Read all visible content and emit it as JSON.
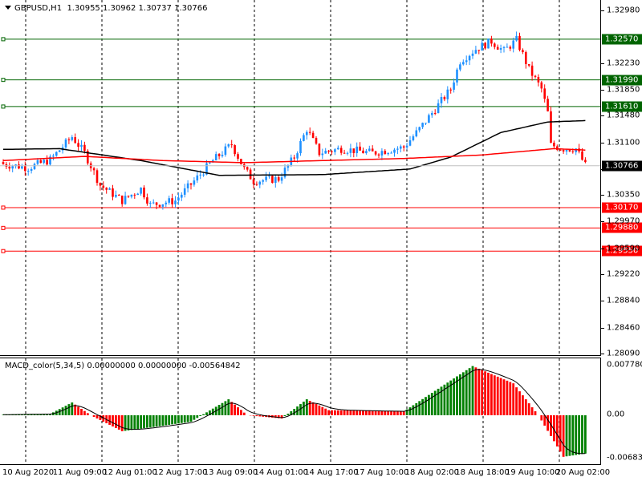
{
  "header": {
    "symbol": "GBPUSD,H1",
    "open": "1.30955",
    "high": "1.30962",
    "low": "1.30737",
    "close": "1.30766"
  },
  "macd": {
    "label": "MACD_color(5,34,5) 0.00000000 0.00000000 -0.00564842",
    "axis": [
      "0.0077804",
      "0.00",
      "-0.006831"
    ]
  },
  "price_axis": [
    "1.32980",
    "1.32230",
    "1.31850",
    "1.31480",
    "1.31100",
    "1.30720",
    "1.30350",
    "1.29970",
    "1.29590",
    "1.29220",
    "1.28840",
    "1.28460",
    "1.28090"
  ],
  "levels": [
    {
      "price": "1.32570",
      "color": "#006400"
    },
    {
      "price": "1.31990",
      "color": "#006400"
    },
    {
      "price": "1.31610",
      "color": "#006400"
    },
    {
      "price": "1.30170",
      "color": "#ff0000"
    },
    {
      "price": "1.29880",
      "color": "#ff0000"
    },
    {
      "price": "1.29550",
      "color": "#ff0000"
    }
  ],
  "current_price": "1.30766",
  "time_axis": [
    "10 Aug 2020",
    "11 Aug 09:00",
    "12 Aug 01:00",
    "12 Aug 17:00",
    "13 Aug 09:00",
    "14 Aug 01:00",
    "14 Aug 17:00",
    "17 Aug 10:00",
    "18 Aug 02:00",
    "18 Aug 18:00",
    "19 Aug 10:00",
    "20 Aug 02:00"
  ],
  "colors": {
    "bull": "#1e90ff",
    "bear": "#ff0000",
    "ma_slow": "#000000",
    "ma_fast": "#ff0000",
    "hist_up": "#008000",
    "hist_down": "#ff0000"
  },
  "chart_data": {
    "type": "candlestick",
    "bars": 187,
    "ylim": [
      1.2809,
      1.3298
    ],
    "close_keypoints": [
      [
        0,
        1.3079
      ],
      [
        8,
        1.3074
      ],
      [
        15,
        1.3085
      ],
      [
        22,
        1.3118
      ],
      [
        26,
        1.3095
      ],
      [
        31,
        1.3049
      ],
      [
        38,
        1.3027
      ],
      [
        44,
        1.3044
      ],
      [
        47,
        1.3021
      ],
      [
        55,
        1.3027
      ],
      [
        61,
        1.3055
      ],
      [
        67,
        1.3084
      ],
      [
        73,
        1.3107
      ],
      [
        77,
        1.3072
      ],
      [
        80,
        1.3055
      ],
      [
        88,
        1.3058
      ],
      [
        93,
        1.3089
      ],
      [
        97,
        1.3129
      ],
      [
        101,
        1.3095
      ],
      [
        108,
        1.3101
      ],
      [
        118,
        1.3095
      ],
      [
        128,
        1.3103
      ],
      [
        133,
        1.3129
      ],
      [
        140,
        1.3169
      ],
      [
        143,
        1.3186
      ],
      [
        146,
        1.3226
      ],
      [
        151,
        1.3243
      ],
      [
        156,
        1.3254
      ],
      [
        160,
        1.324
      ],
      [
        164,
        1.3256
      ],
      [
        168,
        1.3214
      ],
      [
        172,
        1.3186
      ],
      [
        174,
        1.3152
      ],
      [
        175,
        1.3106
      ],
      [
        179,
        1.3101
      ],
      [
        183,
        1.3101
      ],
      [
        186,
        1.3077
      ]
    ],
    "ma_slow_keypoints": [
      [
        0,
        1.31
      ],
      [
        18,
        1.3101
      ],
      [
        44,
        1.3084
      ],
      [
        69,
        1.3063
      ],
      [
        102,
        1.3064
      ],
      [
        130,
        1.3072
      ],
      [
        143,
        1.3089
      ],
      [
        159,
        1.3124
      ],
      [
        174,
        1.3139
      ],
      [
        186,
        1.3141
      ]
    ],
    "ma_fast_keypoints": [
      [
        0,
        1.3084
      ],
      [
        26,
        1.309
      ],
      [
        51,
        1.3084
      ],
      [
        77,
        1.3081
      ],
      [
        102,
        1.3084
      ],
      [
        128,
        1.3087
      ],
      [
        153,
        1.3092
      ],
      [
        176,
        1.3101
      ],
      [
        186,
        1.3099
      ]
    ],
    "macd_keypoints": [
      [
        0,
        0.0001
      ],
      [
        15,
        0.0002
      ],
      [
        22,
        0.002
      ],
      [
        28,
        0.0
      ],
      [
        38,
        -0.0025
      ],
      [
        53,
        -0.0015
      ],
      [
        60,
        -0.001
      ],
      [
        72,
        0.0025
      ],
      [
        78,
        0.0
      ],
      [
        89,
        -0.0005
      ],
      [
        97,
        0.0025
      ],
      [
        104,
        0.0008
      ],
      [
        128,
        0.0006
      ],
      [
        150,
        0.0077
      ],
      [
        163,
        0.005
      ],
      [
        171,
        0.0
      ],
      [
        179,
        -0.0065
      ],
      [
        186,
        -0.006
      ]
    ]
  }
}
